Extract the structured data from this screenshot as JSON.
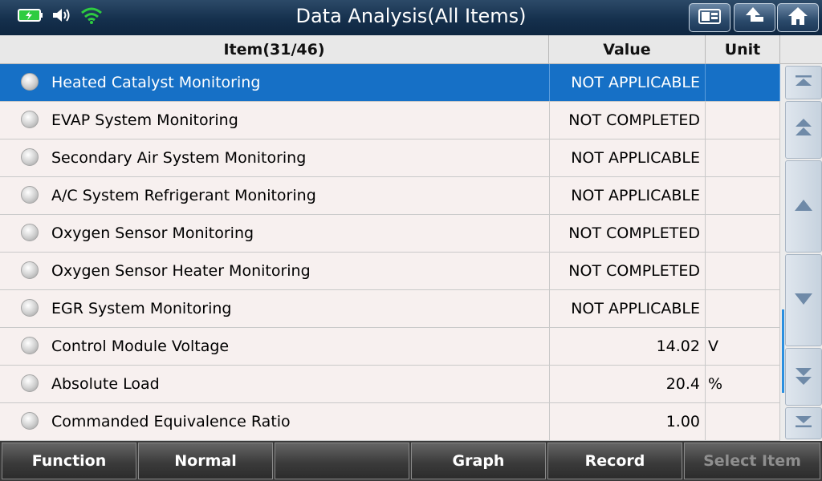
{
  "header": {
    "title": "Data Analysis(All Items)",
    "status_icons": [
      "battery-icon",
      "speaker-icon",
      "wifi-icon"
    ],
    "buttons": [
      "screenshot-icon",
      "back-icon",
      "home-icon"
    ]
  },
  "table": {
    "columns": {
      "item": "Item(31/46)",
      "value": "Value",
      "unit": "Unit"
    },
    "rows": [
      {
        "name": "Heated Catalyst Monitoring",
        "value": "NOT APPLICABLE",
        "unit": "",
        "selected": true
      },
      {
        "name": "EVAP System Monitoring",
        "value": "NOT COMPLETED",
        "unit": ""
      },
      {
        "name": "Secondary Air System Monitoring",
        "value": "NOT APPLICABLE",
        "unit": ""
      },
      {
        "name": "A/C System Refrigerant Monitoring",
        "value": "NOT APPLICABLE",
        "unit": ""
      },
      {
        "name": "Oxygen Sensor Monitoring",
        "value": "NOT COMPLETED",
        "unit": ""
      },
      {
        "name": "Oxygen Sensor Heater Monitoring",
        "value": "NOT COMPLETED",
        "unit": ""
      },
      {
        "name": "EGR System Monitoring",
        "value": "NOT APPLICABLE",
        "unit": ""
      },
      {
        "name": "Control Module Voltage",
        "value": "14.02",
        "unit": "V"
      },
      {
        "name": "Absolute Load",
        "value": "20.4",
        "unit": "%"
      },
      {
        "name": "Commanded Equivalence Ratio",
        "value": "1.00",
        "unit": ""
      }
    ]
  },
  "scroll": {
    "buttons": [
      "scroll-top-icon",
      "page-up-icon",
      "line-up-icon",
      "line-down-icon",
      "page-down-icon",
      "scroll-bottom-icon"
    ]
  },
  "footer": {
    "function": "Function",
    "normal": "Normal",
    "blank": "",
    "graph": "Graph",
    "record": "Record",
    "select_item": "Select Item"
  },
  "colors": {
    "selected_row": "#1670c6",
    "top_bar": "#15304d",
    "wifi": "#2ecc40",
    "scroll_indicator": "#2a8fe0"
  }
}
